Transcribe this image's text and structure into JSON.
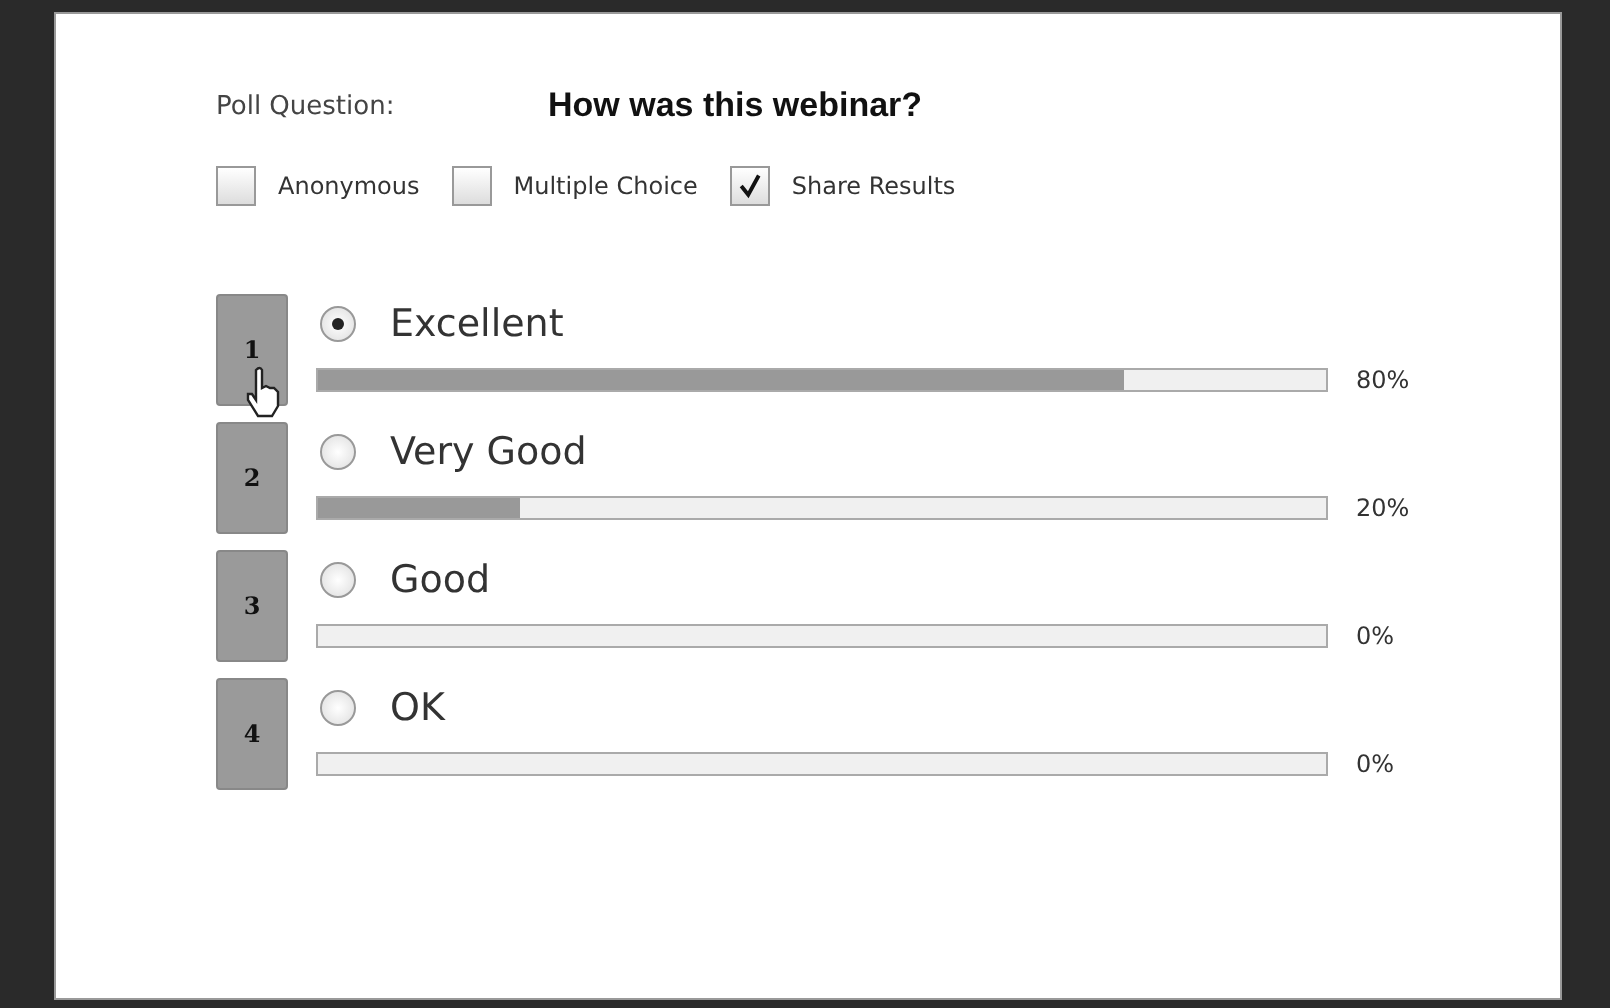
{
  "poll": {
    "question_label": "Poll Question:",
    "question": "How was this webinar?",
    "settings": [
      {
        "label": "Anonymous",
        "checked": false
      },
      {
        "label": "Multiple Choice",
        "checked": false
      },
      {
        "label": "Share Results",
        "checked": true
      }
    ],
    "options": [
      {
        "number": "1",
        "label": "Excellent",
        "selected": true,
        "level": 0.8,
        "reading": "80%"
      },
      {
        "number": "2",
        "label": "Very Good",
        "selected": false,
        "level": 0.2,
        "reading": "20%"
      },
      {
        "number": "3",
        "label": "Good",
        "selected": false,
        "level": 0,
        "reading": "0%"
      },
      {
        "number": "4",
        "label": "OK",
        "selected": false,
        "level": 0,
        "reading": "0%"
      }
    ]
  }
}
